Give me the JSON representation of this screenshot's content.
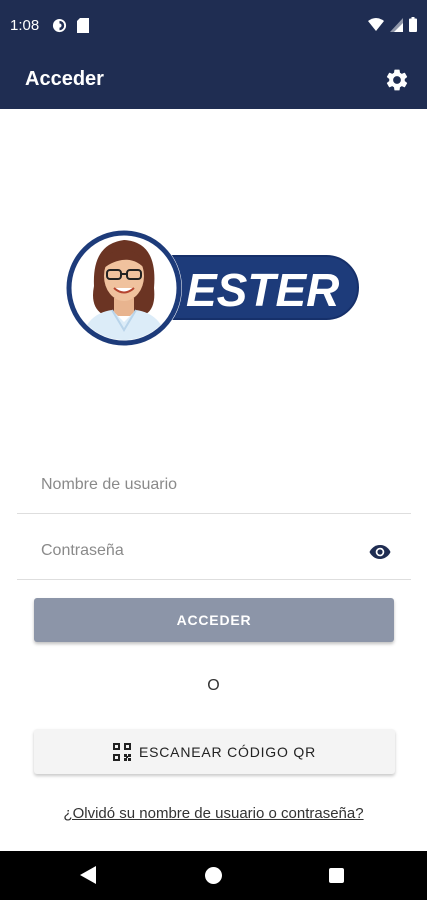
{
  "status_bar": {
    "time": "1:08"
  },
  "app_bar": {
    "title": "Acceder"
  },
  "logo": {
    "wordmark": "ESTER"
  },
  "form": {
    "username_placeholder": "Nombre de usuario",
    "password_placeholder": "Contraseña",
    "login_label": "ACCEDER",
    "or_label": "O",
    "qr_label": "ESCANEAR CÓDIGO QR",
    "forgot_label": "¿Olvidó su nombre de usuario o contraseña?"
  },
  "colors": {
    "primary": "#1f2d52",
    "logo_blue": "#1d3b7a",
    "button_disabled": "#8c95a8"
  }
}
